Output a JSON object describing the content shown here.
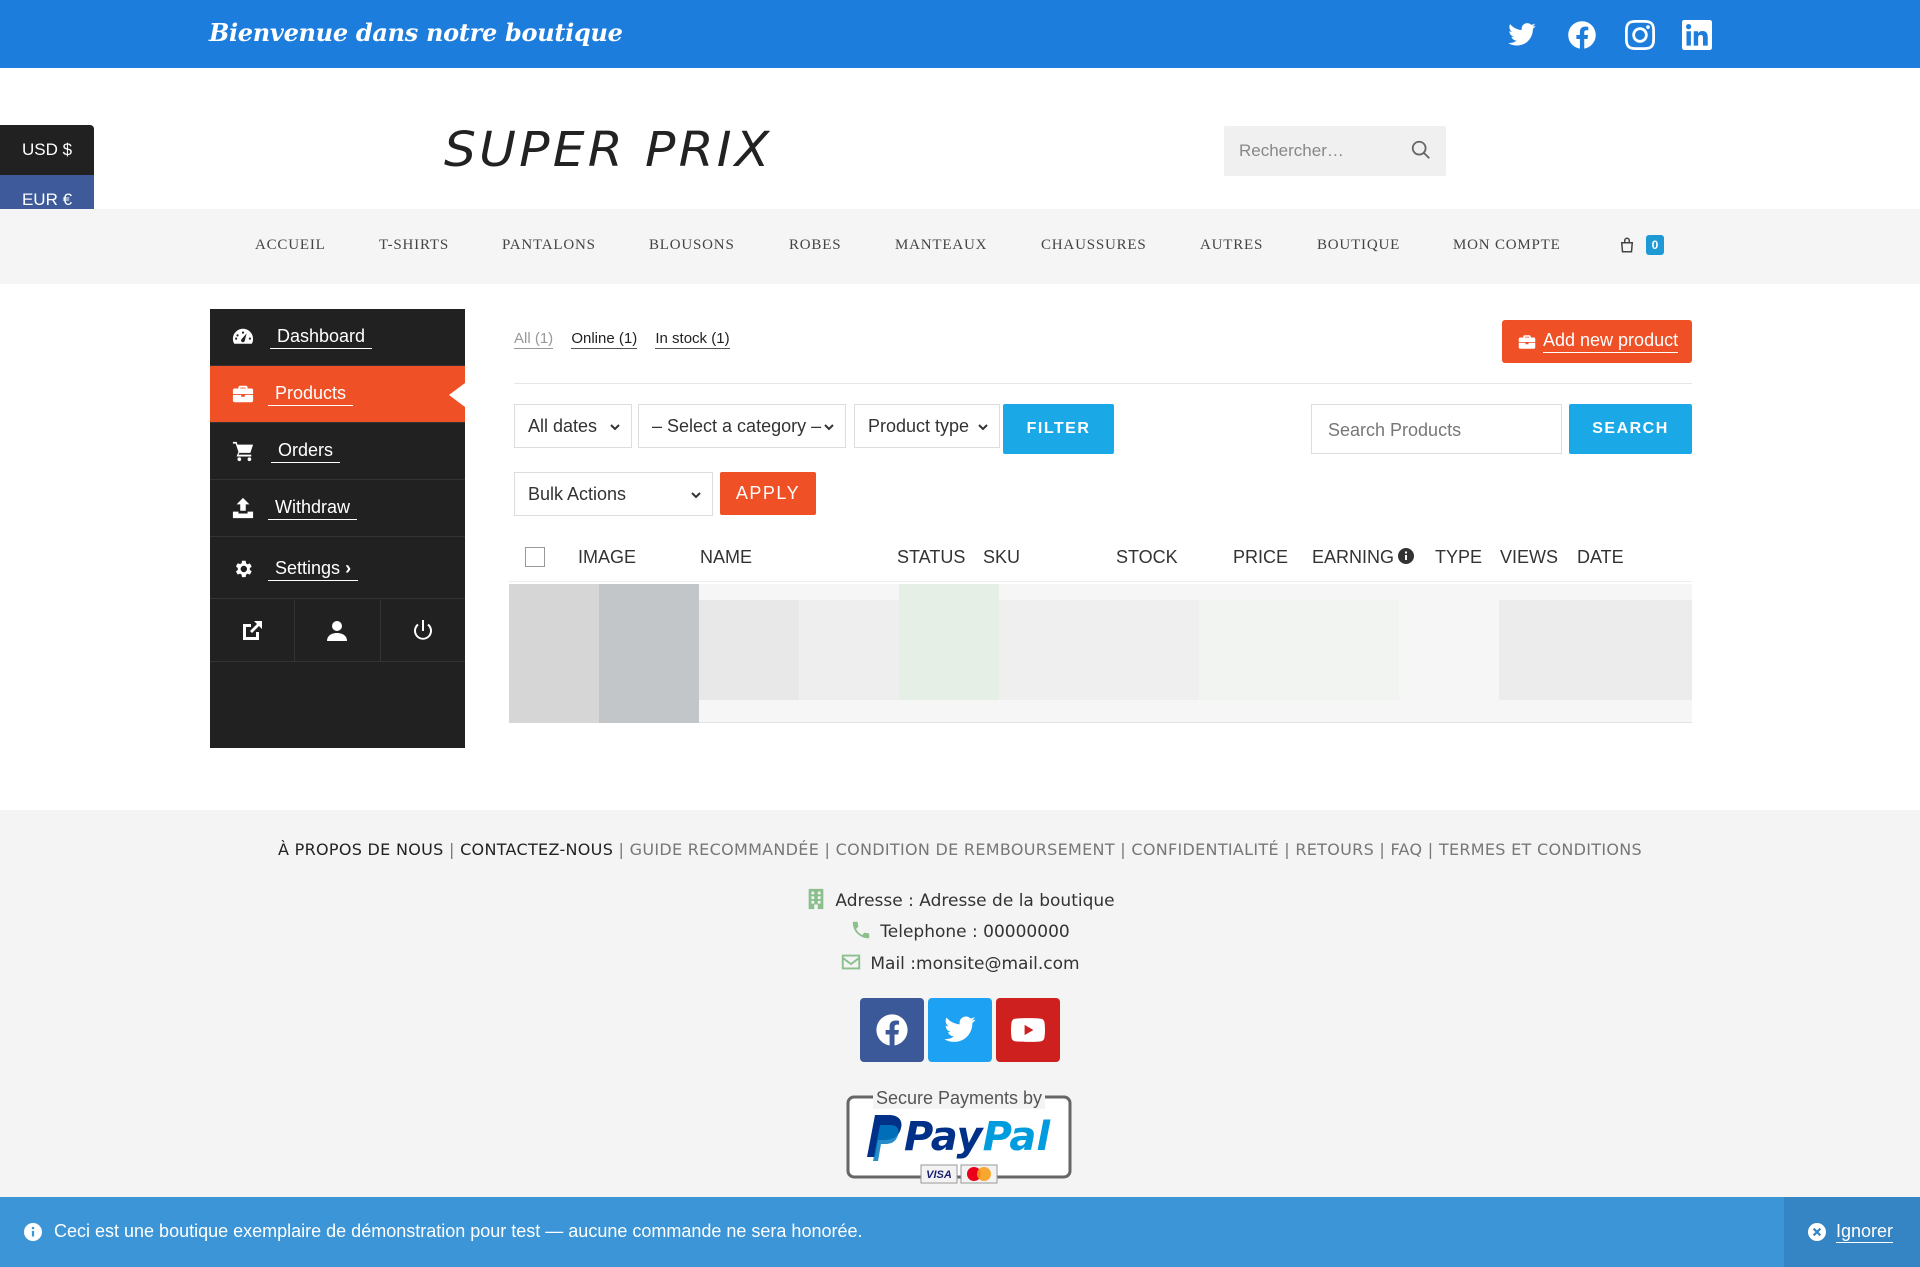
{
  "topbar": {
    "welcome": "Bienvenue dans notre boutique",
    "social": [
      "twitter-icon",
      "facebook-icon",
      "instagram-icon",
      "linkedin-icon"
    ],
    "color": "#1d7ddc"
  },
  "currency": {
    "usd": "USD $",
    "eur": "EUR €"
  },
  "header": {
    "logo": "SUPER PRIX",
    "search_placeholder": "Rechercher…"
  },
  "nav": {
    "items": [
      "ACCUEIL",
      "T-SHIRTS",
      "PANTALONS",
      "BLOUSONS",
      "ROBES",
      "MANTEAUX",
      "CHAUSSURES",
      "AUTRES",
      "BOUTIQUE",
      "MON COMPTE"
    ],
    "cart_count": "0"
  },
  "sidebar": {
    "items": [
      {
        "label": "Dashboard",
        "icon": "dashboard-icon"
      },
      {
        "label": "Products",
        "icon": "briefcase-icon",
        "active": true
      },
      {
        "label": "Orders",
        "icon": "cart-icon"
      },
      {
        "label": "Withdraw",
        "icon": "upload-icon"
      },
      {
        "label": "Settings",
        "icon": "gear-icon"
      }
    ],
    "bottom_icons": [
      "external-link-icon",
      "user-icon",
      "power-icon"
    ],
    "accent": "#f05025"
  },
  "products": {
    "tabs": [
      "All (1)",
      "Online (1)",
      "In stock (1)"
    ],
    "add_button": "Add new product",
    "filters": {
      "dates": "All dates",
      "category": "– Select a category –",
      "type": "Product type",
      "filter_button": "FILTER",
      "search_placeholder": "Search Products",
      "search_button": "SEARCH"
    },
    "bulk": {
      "select": "Bulk Actions",
      "apply": "APPLY"
    },
    "columns": [
      "IMAGE",
      "NAME",
      "STATUS",
      "SKU",
      "STOCK",
      "PRICE",
      "EARNING",
      "TYPE",
      "VIEWS",
      "DATE"
    ]
  },
  "footer": {
    "links": [
      "À PROPOS DE NOUS",
      "CONTACTEZ-NOUS",
      "GUIDE RECOMMANDÉE",
      "CONDITION DE REMBOURSEMENT",
      "CONFIDENTIALITÉ",
      "RETOURS",
      "FAQ",
      "TERMES ET CONDITIONS"
    ],
    "address": "Adresse : Adresse de la boutique",
    "phone": "Telephone : 00000000",
    "mail": "Mail :monsite@mail.com",
    "social": [
      "facebook-icon",
      "twitter-icon",
      "youtube-icon"
    ],
    "paypal_caption": "Secure Payments by",
    "paypal_brand": "PayPal"
  },
  "notice": {
    "message": "Ceci est une boutique exemplaire de démonstration pour test — aucune commande ne sera honorée.",
    "dismiss": "Ignorer"
  }
}
